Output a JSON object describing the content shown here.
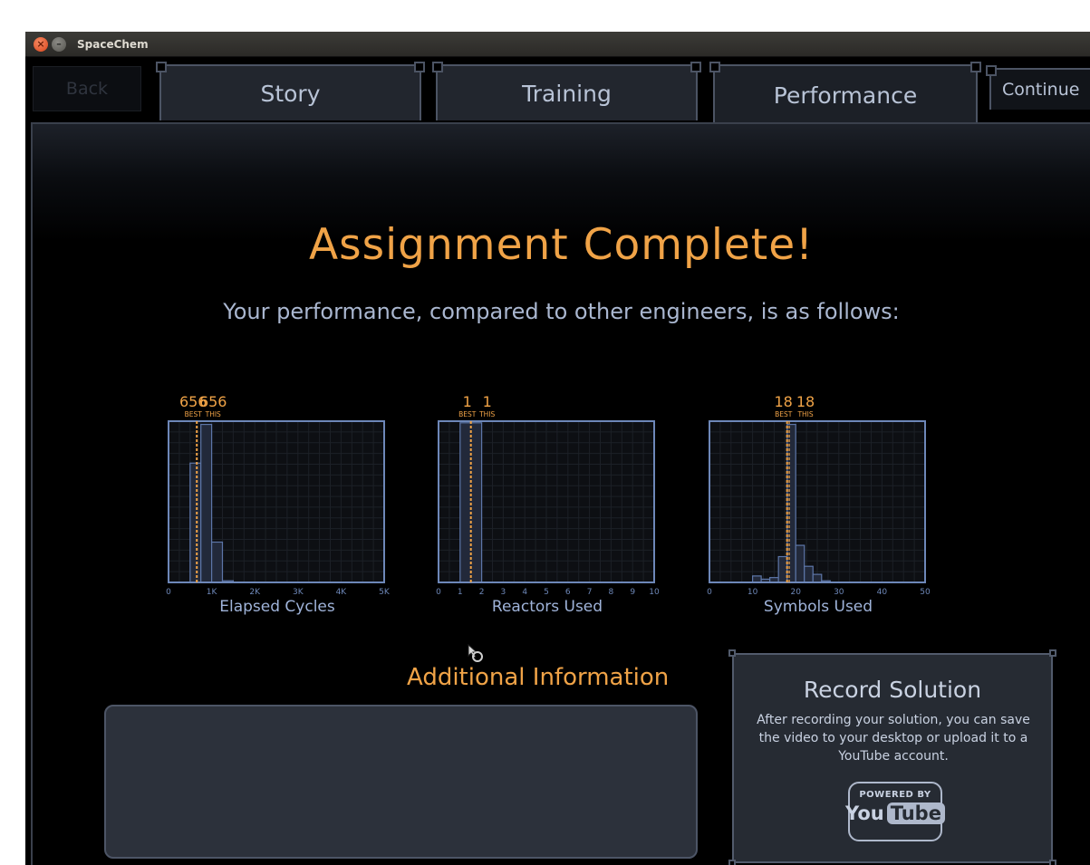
{
  "window": {
    "title": "SpaceChem"
  },
  "tabs": {
    "back": "Back",
    "story": "Story",
    "training": "Training",
    "performance": "Performance",
    "continue": "Continue"
  },
  "panel": {
    "headline": "Assignment Complete!",
    "subtitle": "Your performance, compared to other engineers, is as follows:"
  },
  "colors": {
    "accent": "#f0a347",
    "text": "#aab7d0",
    "chart_border": "#6d87b8"
  },
  "chart_data": [
    {
      "type": "bar",
      "caption": "Elapsed Cycles",
      "xlim": [
        0,
        5000
      ],
      "ticks": [
        {
          "v": 0,
          "label": "0"
        },
        {
          "v": 1000,
          "label": "1K"
        },
        {
          "v": 2000,
          "label": "2K"
        },
        {
          "v": 3000,
          "label": "3K"
        },
        {
          "v": 4000,
          "label": "4K"
        },
        {
          "v": 5000,
          "label": "5K"
        }
      ],
      "bin_width": 250,
      "bins": [
        {
          "x": 500,
          "h": 0.74
        },
        {
          "x": 750,
          "h": 0.98
        },
        {
          "x": 1000,
          "h": 0.25
        },
        {
          "x": 1250,
          "h": 0.01
        }
      ],
      "best": 656,
      "this": 656,
      "best_label": "656",
      "this_label": "656",
      "best_caption": "BEST",
      "this_caption": "THIS"
    },
    {
      "type": "bar",
      "caption": "Reactors Used",
      "xlim": [
        0,
        10
      ],
      "ticks": [
        {
          "v": 0,
          "label": "0"
        },
        {
          "v": 1,
          "label": "1"
        },
        {
          "v": 2,
          "label": "2"
        },
        {
          "v": 3,
          "label": "3"
        },
        {
          "v": 4,
          "label": "4"
        },
        {
          "v": 5,
          "label": "5"
        },
        {
          "v": 6,
          "label": "6"
        },
        {
          "v": 7,
          "label": "7"
        },
        {
          "v": 8,
          "label": "8"
        },
        {
          "v": 9,
          "label": "9"
        },
        {
          "v": 10,
          "label": "10"
        }
      ],
      "bin_width": 1,
      "bins": [
        {
          "x": 1,
          "h": 0.99
        }
      ],
      "best": 1.5,
      "this": 1.5,
      "best_label": "1",
      "this_label": "1",
      "best_caption": "BEST",
      "this_caption": "THIS"
    },
    {
      "type": "bar",
      "caption": "Symbols Used",
      "xlim": [
        0,
        50
      ],
      "ticks": [
        {
          "v": 0,
          "label": "0"
        },
        {
          "v": 10,
          "label": "10"
        },
        {
          "v": 20,
          "label": "20"
        },
        {
          "v": 30,
          "label": "30"
        },
        {
          "v": 40,
          "label": "40"
        },
        {
          "v": 50,
          "label": "50"
        }
      ],
      "bin_width": 2,
      "bins": [
        {
          "x": 10,
          "h": 0.04
        },
        {
          "x": 12,
          "h": 0.02
        },
        {
          "x": 14,
          "h": 0.03
        },
        {
          "x": 16,
          "h": 0.16
        },
        {
          "x": 18,
          "h": 0.98
        },
        {
          "x": 20,
          "h": 0.23
        },
        {
          "x": 22,
          "h": 0.1
        },
        {
          "x": 24,
          "h": 0.05
        },
        {
          "x": 26,
          "h": 0.01
        }
      ],
      "best": 18,
      "this": 18.5,
      "best_label": "18",
      "this_label": "18",
      "best_caption": "BEST",
      "this_caption": "THIS"
    }
  ],
  "additional": {
    "title": "Additional Information"
  },
  "record": {
    "title": "Record Solution",
    "description": "After recording your solution, you can save the video to your desktop or upload it to a YouTube account.",
    "powered_by": "POWERED BY",
    "you": "You",
    "tube": "Tube"
  }
}
